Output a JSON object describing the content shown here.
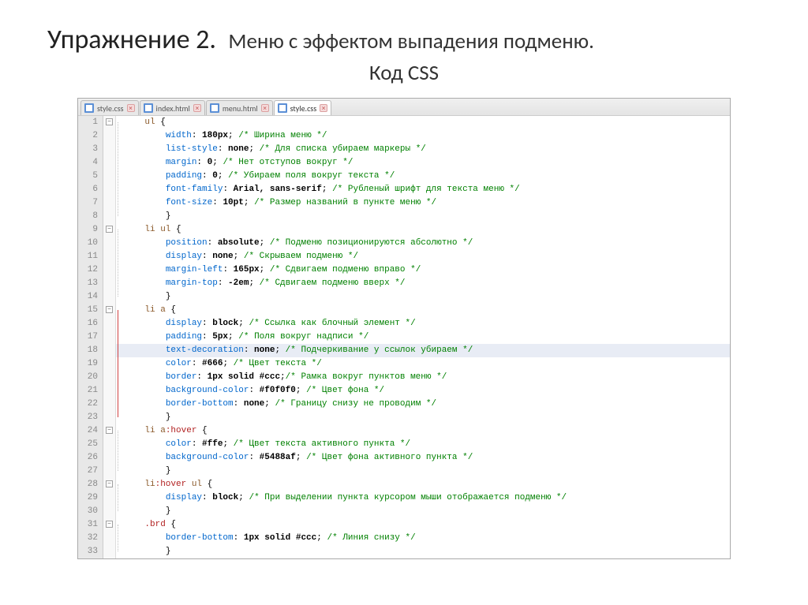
{
  "slide": {
    "title_main": "Упражнение 2.",
    "title_sub": "Меню с эффектом выпадения подменю.",
    "title_sub2": "Код CSS"
  },
  "tabs": [
    {
      "label": "style.css",
      "active": false
    },
    {
      "label": "index.html",
      "active": false
    },
    {
      "label": "menu.html",
      "active": false
    },
    {
      "label": "style.css",
      "active": true
    }
  ],
  "folds": [
    {
      "line": 1,
      "sym": "−"
    },
    {
      "line": 9,
      "sym": "−"
    },
    {
      "line": 15,
      "sym": "−"
    },
    {
      "line": 24,
      "sym": "−"
    },
    {
      "line": 28,
      "sym": "−"
    },
    {
      "line": 31,
      "sym": "−"
    }
  ],
  "code_lines": [
    {
      "n": 1,
      "indent": 1,
      "type": "sel-open",
      "selector": "ul",
      "brace": " {"
    },
    {
      "n": 2,
      "indent": 2,
      "type": "decl",
      "prop": "width",
      "val": "180px",
      "comment": "/* Ширина меню */"
    },
    {
      "n": 3,
      "indent": 2,
      "type": "decl",
      "prop": "list-style",
      "val": "none",
      "comment": "/* Для списка убираем маркеры */"
    },
    {
      "n": 4,
      "indent": 2,
      "type": "decl",
      "prop": "margin",
      "val": "0",
      "comment": "/* Нет отступов вокруг */"
    },
    {
      "n": 5,
      "indent": 2,
      "type": "decl",
      "prop": "padding",
      "val": "0",
      "comment": "/* Убираем поля вокруг текста */"
    },
    {
      "n": 6,
      "indent": 2,
      "type": "decl",
      "prop": "font-family",
      "val": "Arial, sans-serif",
      "comment": "/* Рубленый шрифт для текста меню */"
    },
    {
      "n": 7,
      "indent": 2,
      "type": "decl",
      "prop": "font-size",
      "val": "10pt",
      "comment": "/* Размер названий в пункте меню */"
    },
    {
      "n": 8,
      "indent": 2,
      "type": "brace-close",
      "text": "}"
    },
    {
      "n": 9,
      "indent": 1,
      "type": "sel-open",
      "selector": "li ul",
      "brace": " {"
    },
    {
      "n": 10,
      "indent": 2,
      "type": "decl",
      "prop": "position",
      "val": "absolute",
      "comment": "/* Подменю позиционируются абсолютно */"
    },
    {
      "n": 11,
      "indent": 2,
      "type": "decl",
      "prop": "display",
      "val": "none",
      "comment": "/* Скрываем подменю */"
    },
    {
      "n": 12,
      "indent": 2,
      "type": "decl",
      "prop": "margin-left",
      "val": "165px",
      "comment": "/* Сдвигаем подменю вправо */"
    },
    {
      "n": 13,
      "indent": 2,
      "type": "decl",
      "prop": "margin-top",
      "val": "-2em",
      "comment": "/* Сдвигаем подменю вверх */"
    },
    {
      "n": 14,
      "indent": 2,
      "type": "brace-close",
      "text": "}"
    },
    {
      "n": 15,
      "indent": 1,
      "type": "sel-open",
      "selector": "li a",
      "brace": " {"
    },
    {
      "n": 16,
      "indent": 2,
      "type": "decl",
      "prop": "display",
      "val": "block",
      "comment": "/* Ссылка как блочный элемент */"
    },
    {
      "n": 17,
      "indent": 2,
      "type": "decl",
      "prop": "padding",
      "val": "5px",
      "comment": "/* Поля вокруг надписи */"
    },
    {
      "n": 18,
      "indent": 2,
      "type": "decl",
      "highlight": true,
      "prop": "text-decoration",
      "val": "none",
      "comment": "/* Подчеркивание у ссылок убираем */"
    },
    {
      "n": 19,
      "indent": 2,
      "type": "decl",
      "prop": "color",
      "val": "#666",
      "comment": "/* Цвет текста */"
    },
    {
      "n": 20,
      "indent": 2,
      "type": "decl",
      "prop": "border",
      "val": "1px solid #ccc",
      "nosep": true,
      "comment": "/* Рамка вокруг пунктов меню */"
    },
    {
      "n": 21,
      "indent": 2,
      "type": "decl",
      "prop": "background-color",
      "val": "#f0f0f0",
      "comment": "/* Цвет фона */"
    },
    {
      "n": 22,
      "indent": 2,
      "type": "decl",
      "prop": "border-bottom",
      "val": "none",
      "comment": "/* Границу снизу не проводим */"
    },
    {
      "n": 23,
      "indent": 2,
      "type": "brace-close",
      "text": "}"
    },
    {
      "n": 24,
      "indent": 1,
      "type": "sel-pseudo-open",
      "selector": "li a",
      "pseudo": ":hover",
      "brace": " {"
    },
    {
      "n": 25,
      "indent": 2,
      "type": "decl",
      "prop": "color",
      "val": "#ffe",
      "comment": "/* Цвет текста активного пункта */"
    },
    {
      "n": 26,
      "indent": 2,
      "type": "decl",
      "prop": "background-color",
      "val": "#5488af",
      "comment": "/* Цвет фона активного пункта */"
    },
    {
      "n": 27,
      "indent": 2,
      "type": "brace-close",
      "text": "}"
    },
    {
      "n": 28,
      "indent": 1,
      "type": "sel-pseudo-open",
      "selector": "li",
      "pseudo": ":hover",
      "sel2": " ul",
      "brace": " {"
    },
    {
      "n": 29,
      "indent": 2,
      "type": "decl",
      "prop": "display",
      "val": "block",
      "comment": "/* При выделении пункта курсором мыши отображается подменю */"
    },
    {
      "n": 30,
      "indent": 2,
      "type": "brace-close",
      "text": "}"
    },
    {
      "n": 31,
      "indent": 1,
      "type": "sel-class-open",
      "selector": ".brd",
      "brace": " {"
    },
    {
      "n": 32,
      "indent": 2,
      "type": "decl",
      "prop": "border-bottom",
      "val": "1px solid #ccc",
      "comment": "/* Линия снизу */"
    },
    {
      "n": 33,
      "indent": 2,
      "type": "brace-close",
      "text": "}"
    }
  ],
  "bracket_guides": {
    "gray": [
      {
        "start": 1,
        "end": 8
      },
      {
        "start": 9,
        "end": 14
      },
      {
        "start": 24,
        "end": 27
      },
      {
        "start": 28,
        "end": 30
      },
      {
        "start": 31,
        "end": 33
      }
    ],
    "red": {
      "start": 15,
      "end": 23
    }
  }
}
